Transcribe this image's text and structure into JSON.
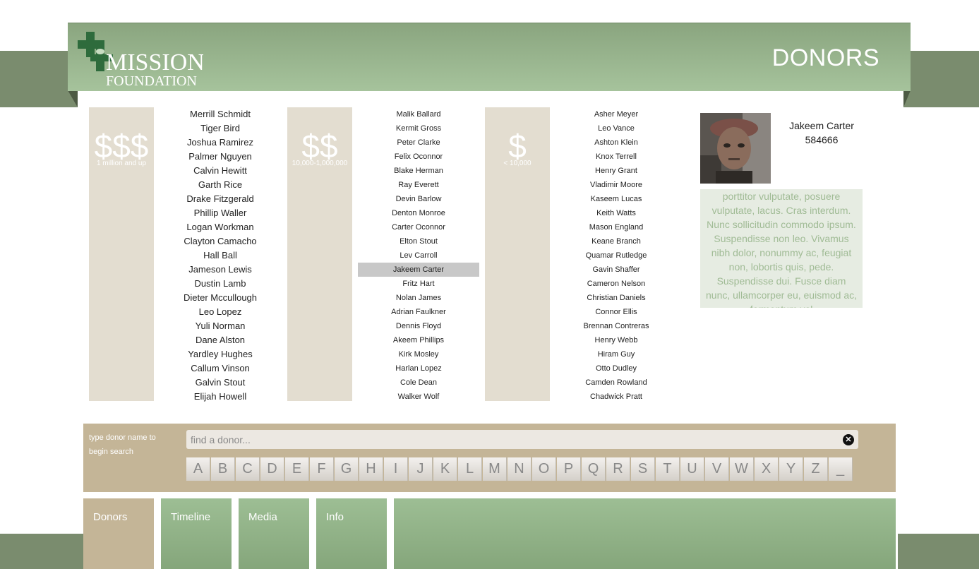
{
  "header": {
    "logo_line1": "MISSION",
    "logo_line2": "FOUNDATION",
    "title": "DONORS"
  },
  "tiers": [
    {
      "symbol": "$$$",
      "range": "1 million and up"
    },
    {
      "symbol": "$$",
      "range": "10,000-1,000,000"
    },
    {
      "symbol": "$",
      "range": "< 10,000"
    }
  ],
  "columns": {
    "tier1": [
      "Merrill Schmidt",
      "Tiger Bird",
      "Joshua Ramirez",
      "Palmer Nguyen",
      "Calvin Hewitt",
      "Garth Rice",
      "Drake Fitzgerald",
      "Phillip Waller",
      "Logan Workman",
      "Clayton Camacho",
      "Hall Ball",
      "Jameson Lewis",
      "Dustin Lamb",
      "Dieter Mccullough",
      "Leo Lopez",
      "Yuli Norman",
      "Dane Alston",
      "Yardley Hughes",
      "Callum Vinson",
      "Galvin Stout",
      "Elijah Howell"
    ],
    "tier2": [
      "Malik Ballard",
      "Kermit Gross",
      "Peter Clarke",
      "Felix Oconnor",
      "Blake Herman",
      "Ray Everett",
      "Devin Barlow",
      "Denton Monroe",
      "Carter Oconnor",
      "Elton Stout",
      "Lev Carroll",
      "Jakeem Carter",
      "Fritz Hart",
      "Nolan James",
      "Adrian Faulkner",
      "Dennis Floyd",
      "Akeem Phillips",
      "Kirk Mosley",
      "Harlan Lopez",
      "Cole Dean",
      "Walker Wolf"
    ],
    "tier3": [
      "Asher Meyer",
      "Leo Vance",
      "Ashton Klein",
      "Knox Terrell",
      "Henry Grant",
      "Vladimir Moore",
      "Kaseem Lucas",
      "Keith Watts",
      "Mason England",
      "Keane Branch",
      "Quamar Rutledge",
      "Gavin Shaffer",
      "Cameron Nelson",
      "Christian Daniels",
      "Connor Ellis",
      "Brennan Contreras",
      "Henry Webb",
      "Hiram Guy",
      "Otto Dudley",
      "Camden Rowland",
      "Chadwick Pratt"
    ]
  },
  "selected_donor": {
    "name": "Jakeem Carter",
    "id": "584666",
    "bio": "porttitor vulputate, posuere vulputate, lacus. Cras interdum. Nunc sollicitudin commodo ipsum. Suspendisse non leo. Vivamus nibh dolor, nonummy ac, feugiat non, lobortis quis, pede. Suspendisse dui. Fusce diam nunc, ullamcorper eu, euismod ac, fermentum vel"
  },
  "search": {
    "hint": "type donor name to begin search",
    "placeholder": "find a donor...",
    "value": "",
    "clear_icon": "close-circle-icon",
    "letters": [
      "A",
      "B",
      "C",
      "D",
      "E",
      "F",
      "G",
      "H",
      "I",
      "J",
      "K",
      "L",
      "M",
      "N",
      "O",
      "P",
      "Q",
      "R",
      "S",
      "T",
      "U",
      "V",
      "W",
      "X",
      "Y",
      "Z",
      "_"
    ]
  },
  "nav": {
    "tabs": [
      "Donors",
      "Timeline",
      "Media",
      "Info"
    ],
    "active": "Donors"
  },
  "colors": {
    "header_green": "#9bbb91",
    "ribbon": "#7a8c6e",
    "tier_bg": "#e3ddd0",
    "search_bg": "#c4b597",
    "logo_green": "#2e6b3c"
  }
}
